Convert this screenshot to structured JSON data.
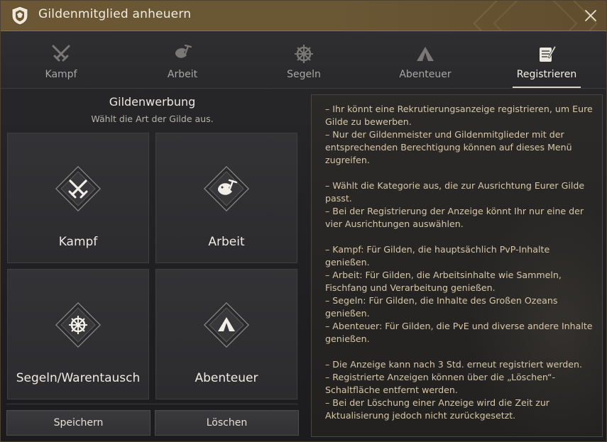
{
  "window": {
    "title": "Gildenmitglied anheuern"
  },
  "tabs": [
    {
      "label": "Kampf",
      "icon": "crossed-swords-icon"
    },
    {
      "label": "Arbeit",
      "icon": "fish-pickaxe-icon"
    },
    {
      "label": "Segeln",
      "icon": "ship-wheel-icon"
    },
    {
      "label": "Abenteuer",
      "icon": "tent-icon"
    },
    {
      "label": "Registrieren",
      "icon": "scroll-quill-icon",
      "active": true
    }
  ],
  "left": {
    "title": "Gildenwerbung",
    "subtitle": "Wählt die Art der Gilde aus.",
    "cards": [
      {
        "label": "Kampf",
        "icon": "crossed-swords-icon"
      },
      {
        "label": "Arbeit",
        "icon": "fish-pickaxe-icon"
      },
      {
        "label": "Segeln/Warentausch",
        "icon": "ship-wheel-icon"
      },
      {
        "label": "Abenteuer",
        "icon": "tent-icon"
      }
    ],
    "save_label": "Speichern",
    "delete_label": "Löschen"
  },
  "info": {
    "lines": [
      "–  Ihr könnt eine Rekrutierungsanzeige registrieren, um Eure Gilde zu bewerben.",
      "–  Nur der Gildenmeister und Gildenmitglieder mit der entsprechenden Berechtigung können auf dieses Menü zugreifen.",
      "",
      "–  Wählt die Kategorie aus, die zur Ausrichtung Eurer Gilde passt.",
      "–  Bei der Registrierung der Anzeige könnt Ihr nur eine der vier Ausrichtungen auswählen.",
      "",
      "–  Kampf: Für Gilden, die hauptsächlich PvP-Inhalte genießen.",
      "–  Arbeit: Für Gilden, die Arbeitsinhalte wie Sammeln, Fischfang und Verarbeitung genießen.",
      "–  Segeln: Für Gilden, die Inhalte des Großen Ozeans genießen.",
      "–  Abenteuer: Für Gilden, die PvE und diverse andere Inhalte genießen.",
      "",
      "–  Die Anzeige kann nach 3 Std. erneut registriert werden.",
      "–  Registrierte Anzeigen können über die „Löschen“-Schaltfläche entfernt werden.",
      "–  Bei der Löschung einer Anzeige wird die Zeit zur Aktualisierung jedoch nicht zurückgesetzt."
    ]
  },
  "colors": {
    "accent": "#6b5733",
    "info_text": "#d7c7a6"
  }
}
